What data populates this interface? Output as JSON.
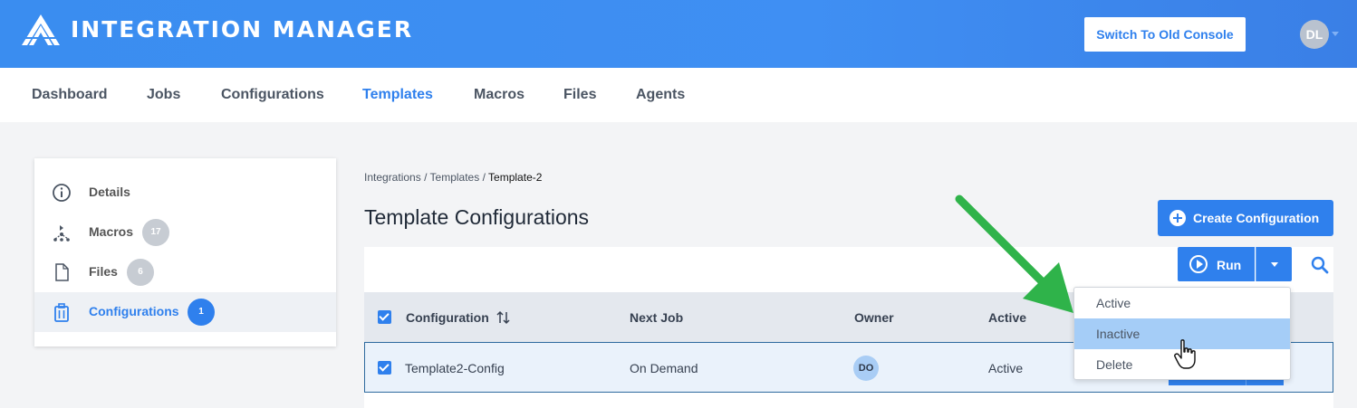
{
  "header": {
    "app_title": "INTEGRATION MANAGER",
    "switch_button": "Switch To Old Console",
    "avatar_initials": "DL"
  },
  "nav": {
    "items": [
      "Dashboard",
      "Jobs",
      "Configurations",
      "Templates",
      "Macros",
      "Files",
      "Agents"
    ],
    "active": "Templates"
  },
  "sidebar": {
    "items": [
      {
        "label": "Details",
        "icon": "info-icon",
        "badge": null
      },
      {
        "label": "Macros",
        "icon": "macro-flow-icon",
        "badge": "17"
      },
      {
        "label": "Files",
        "icon": "file-icon",
        "badge": "6"
      },
      {
        "label": "Configurations",
        "icon": "trash-clipboard-icon",
        "badge": "1",
        "selected": true
      }
    ]
  },
  "breadcrumb": {
    "part1": "Integrations",
    "part2": "Templates",
    "current": "Template-2",
    "sep": "/"
  },
  "page_title": "Template Configurations",
  "actions": {
    "create_label": "Create Configuration",
    "run_label": "Run"
  },
  "table": {
    "columns": [
      "Configuration",
      "Next Job",
      "Owner",
      "Active"
    ],
    "rows": [
      {
        "configuration": "Template2-Config",
        "next_job": "On Demand",
        "owner": "DO",
        "active": "Active"
      }
    ]
  },
  "dropdown": {
    "items": [
      "Active",
      "Inactive",
      "Delete"
    ],
    "hovered": "Inactive"
  },
  "colors": {
    "accent": "#2f80ed",
    "header_blue": "#3a8df0",
    "annotation_arrow": "#2fb34a"
  }
}
